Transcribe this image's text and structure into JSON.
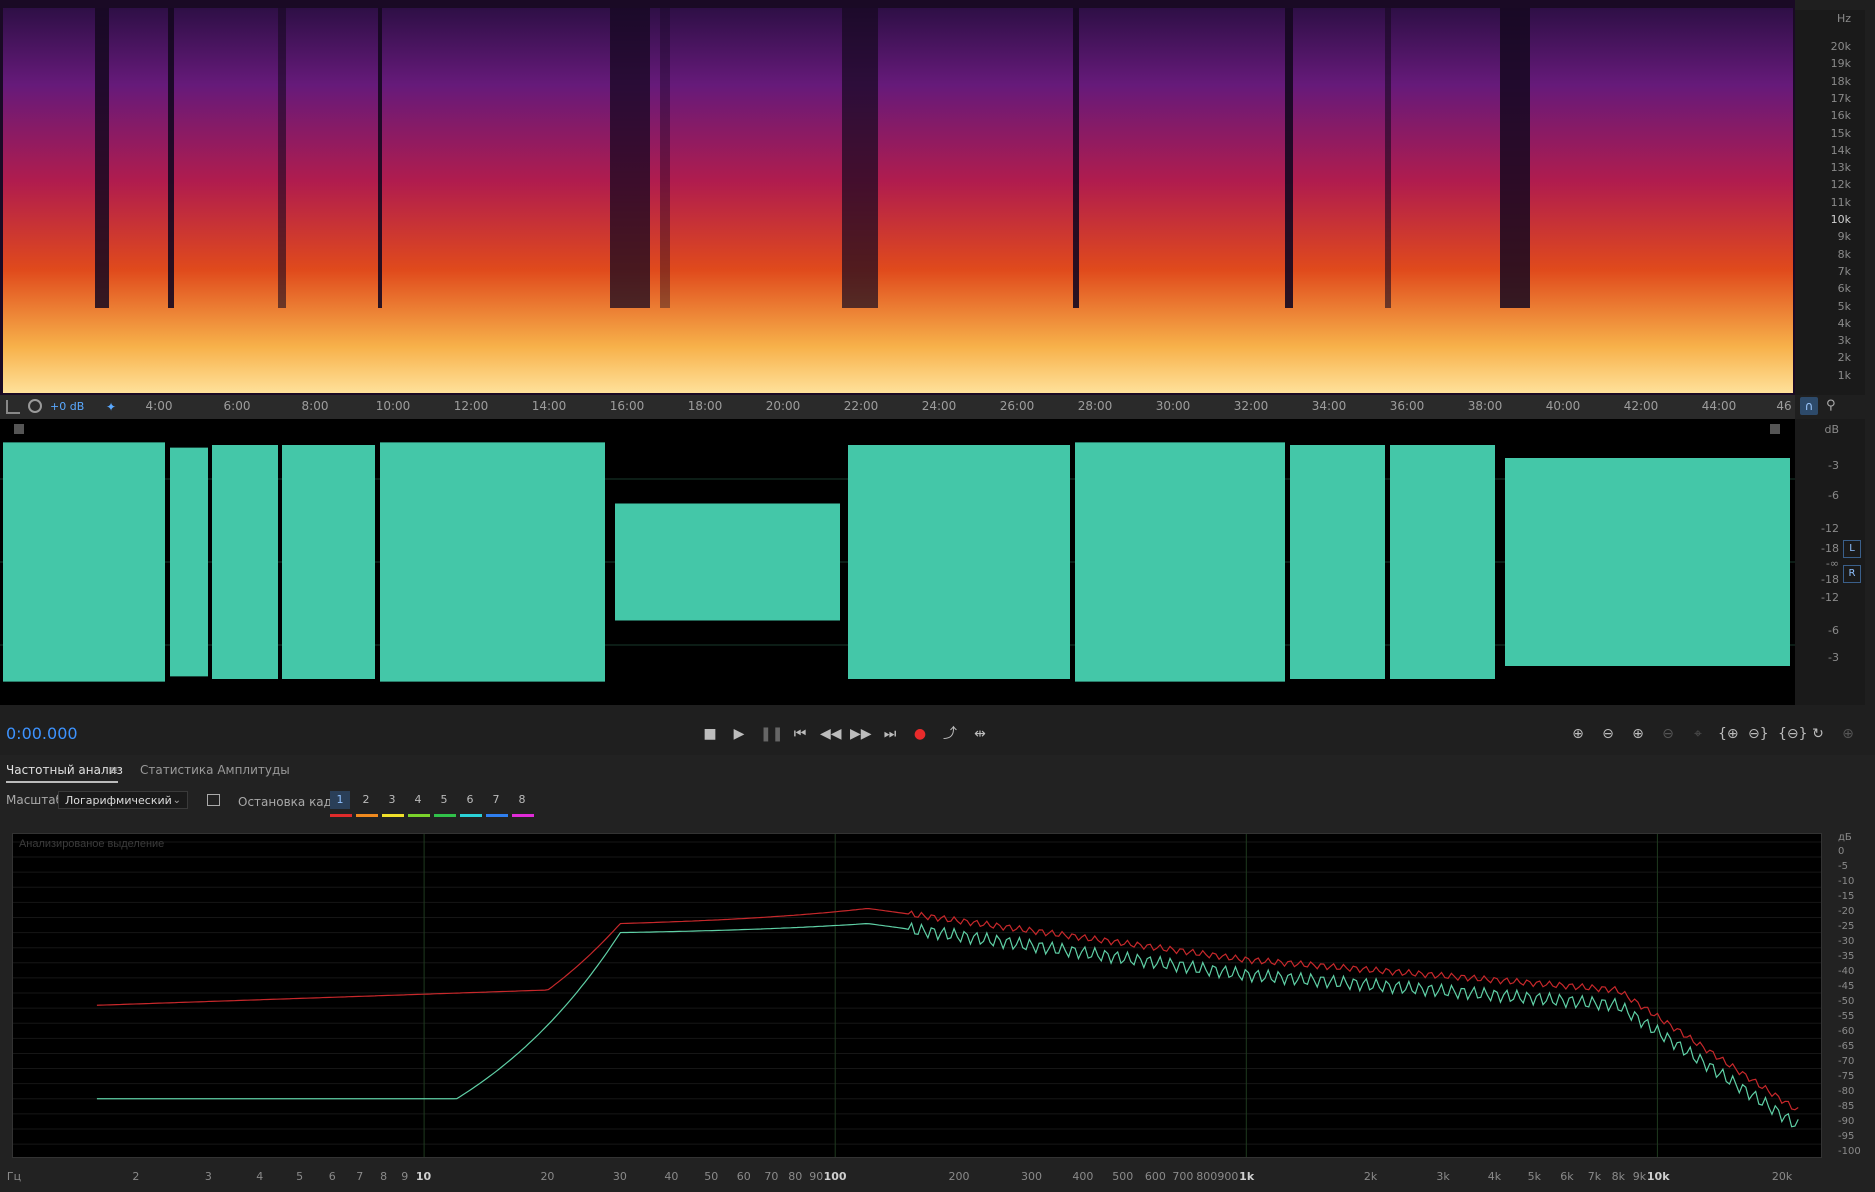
{
  "spectral": {
    "hz_unit": "Hz",
    "hz_labels": [
      "20k",
      "19k",
      "18k",
      "17k",
      "16k",
      "15k",
      "14k",
      "13k",
      "12k",
      "11k",
      "10k",
      "9k",
      "8k",
      "7k",
      "6k",
      "5k",
      "4k",
      "3k",
      "2k",
      "1k"
    ]
  },
  "timeline": {
    "gain": "+0 dB",
    "labels": [
      "4:00",
      "6:00",
      "8:00",
      "10:00",
      "12:00",
      "14:00",
      "16:00",
      "18:00",
      "20:00",
      "22:00",
      "24:00",
      "26:00",
      "28:00",
      "30:00",
      "32:00",
      "34:00",
      "36:00",
      "38:00",
      "40:00",
      "42:00",
      "44:00",
      "46"
    ]
  },
  "waveform": {
    "db_unit": "dB",
    "db_labels": [
      "-3",
      "-6",
      "-12",
      "-18",
      "-∞",
      "-18",
      "-12",
      "-6",
      "-3"
    ],
    "channel_top": "L",
    "channel_bottom": "R",
    "color": "#44c7a8"
  },
  "transport": {
    "time": "0:00.000"
  },
  "panel": {
    "tab_active": "Частотный анализ",
    "tab_other": "Статистика Амплитуды",
    "scale_label": "Масштаб:",
    "scale_value": "Логарифмический",
    "freeze_label": "Остановка кадра:",
    "frames": [
      "1",
      "2",
      "3",
      "4",
      "5",
      "6",
      "7",
      "8"
    ],
    "frame_colors": [
      "#e02b2b",
      "#f08a1f",
      "#f0e02a",
      "#7bd32b",
      "#31c24a",
      "#2bd2d8",
      "#2f7ff0",
      "#e02bd8"
    ]
  },
  "freq_plot": {
    "overlay_label": "Анализированое выделение",
    "db_unit": "дБ",
    "db_labels": [
      "0",
      "-5",
      "-10",
      "-15",
      "-20",
      "-25",
      "-30",
      "-35",
      "-40",
      "-45",
      "-50",
      "-55",
      "-60",
      "-65",
      "-70",
      "-75",
      "-80",
      "-85",
      "-90",
      "-95",
      "-100"
    ],
    "x_unit": "Гц",
    "x_labels": [
      "2",
      "3",
      "4",
      "5",
      "6",
      "7",
      "8",
      "9",
      "10",
      "20",
      "30",
      "40",
      "50",
      "60",
      "70",
      "80",
      "90",
      "100",
      "200",
      "300",
      "400",
      "500",
      "600",
      "700",
      "800",
      "900",
      "1k",
      "2k",
      "3k",
      "4k",
      "5k",
      "6k",
      "7k",
      "8k",
      "9k",
      "10k",
      "20k"
    ],
    "series_colors": [
      "#c7282b",
      "#5fd0a6"
    ]
  }
}
